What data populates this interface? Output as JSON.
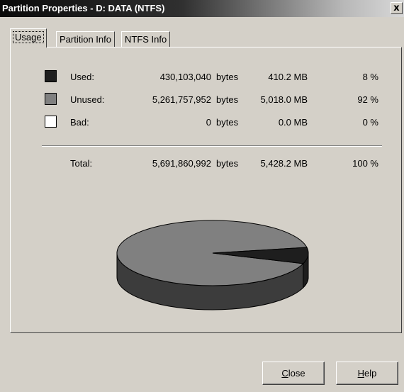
{
  "window": {
    "title": "Partition Properties - D: DATA (NTFS)",
    "close_glyph": "x"
  },
  "tabs": [
    {
      "label": "Usage",
      "active": true
    },
    {
      "label": "Partition Info",
      "active": false
    },
    {
      "label": "NTFS Info",
      "active": false
    }
  ],
  "usage": {
    "rows": [
      {
        "label": "Used:",
        "bytes": "430,103,040",
        "unit": "bytes",
        "mb": "410.2 MB",
        "percent": "8 %",
        "swatch_color": "#1e1e1e"
      },
      {
        "label": "Unused:",
        "bytes": "5,261,757,952",
        "unit": "bytes",
        "mb": "5,018.0 MB",
        "percent": "92 %",
        "swatch_color": "#808080"
      },
      {
        "label": "Bad:",
        "bytes": "0",
        "unit": "bytes",
        "mb": "0.0 MB",
        "percent": "0 %",
        "swatch_color": "#ffffff"
      }
    ],
    "total": {
      "label": "Total:",
      "bytes": "5,691,860,992",
      "unit": "bytes",
      "mb": "5,428.2 MB",
      "percent": "100 %"
    }
  },
  "pie": {
    "used_fraction": 0.08,
    "unused_fraction": 0.92,
    "bad_fraction": 0
  },
  "buttons": {
    "close": {
      "mnemonic": "C",
      "rest": "lose"
    },
    "help": {
      "mnemonic": "H",
      "rest": "elp"
    }
  }
}
